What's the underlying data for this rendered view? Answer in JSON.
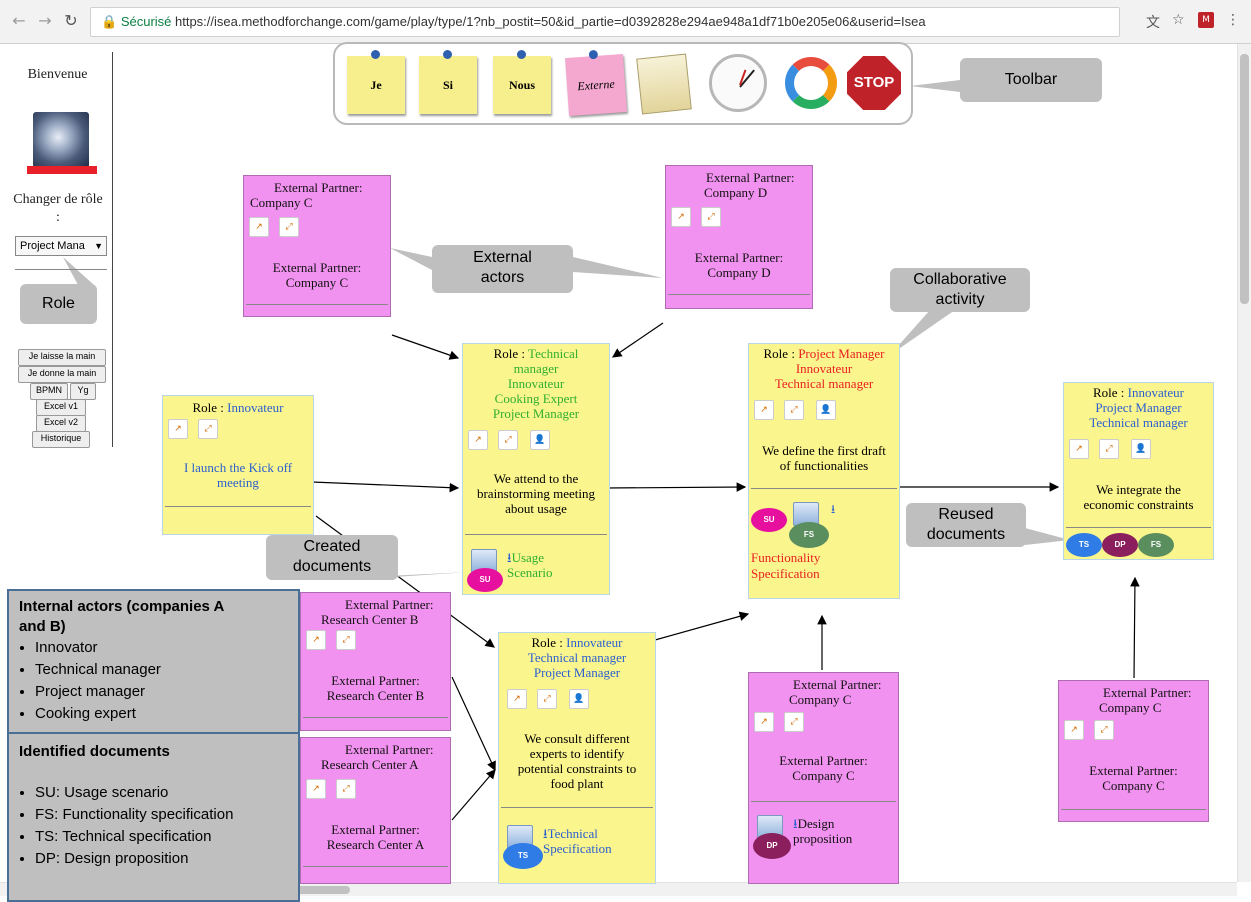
{
  "browser": {
    "secure_label": "Sécurisé",
    "url": "https://isea.methodforchange.com/game/play/type/1?nb_postit=50&id_partie=d0392828e294ae948a1df71b0e205e06&userid=Isea"
  },
  "sidebar": {
    "welcome": "Bienvenue",
    "change_role": "Changer de rôle",
    "change_role_colon": ":",
    "role_value": "Project Mana",
    "buttons": {
      "leave_hand": "Je laisse la main",
      "give_hand": "Je donne la main",
      "bpmn": "BPMN",
      "yg": "Yg",
      "excel_v1": "Excel v1",
      "excel_v2": "Excel v2",
      "history": "Historique"
    }
  },
  "toolbar": {
    "notes": [
      "Je",
      "Si",
      "Nous",
      "Externe"
    ],
    "stop_label": "STOP"
  },
  "callouts": {
    "toolbar": "Toolbar",
    "external_actors": [
      "External",
      "actors"
    ],
    "role": "Role",
    "collaborative": [
      "Collaborative",
      "activity"
    ],
    "created_docs": [
      "Created",
      "documents"
    ],
    "reused_docs": [
      "Reused",
      "documents"
    ]
  },
  "pink_cards": [
    {
      "top": "External Partner:",
      "top2": "Company C",
      "bottom": "External Partner:",
      "bottom2": "Company C"
    },
    {
      "top": "External Partner:",
      "top2": "Company D",
      "bottom": "External Partner:",
      "bottom2": "Company D"
    },
    {
      "top": "External Partner:",
      "top2": "Research Center B",
      "bottom": "External Partner:",
      "bottom2": "Research Center B"
    },
    {
      "top": "External Partner:",
      "top2": "Research Center A",
      "bottom": "External Partner:",
      "bottom2": "Research Center A"
    },
    {
      "top": "External Partner:",
      "top2": "Company C",
      "bottom": "External Partner:",
      "bottom2": "Company C",
      "doc": "Design",
      "doc2": "proposition"
    },
    {
      "top": "External Partner:",
      "top2": "Company C",
      "bottom": "External Partner:",
      "bottom2": "Company C"
    }
  ],
  "yellow_cards": {
    "innovateur": {
      "role_label": "Role :",
      "roles": [
        "Innovateur"
      ],
      "text": [
        "I launch the Kick off",
        "meeting"
      ]
    },
    "brainstorm": {
      "role_label": "Role :",
      "roles": [
        "Technical",
        "manager",
        "Innovateur",
        "Cooking Expert",
        "Project Manager"
      ],
      "text": [
        "We attend to the",
        "brainstorming meeting",
        "about usage"
      ],
      "doc": [
        "Usage",
        "Scenario"
      ]
    },
    "first_draft": {
      "role_label": "Role :",
      "roles": [
        "Project Manager",
        "Innovateur",
        "Technical manager"
      ],
      "text": [
        "We define the first draft",
        "of functionalities"
      ],
      "doc": [
        "Functionality",
        "Specification"
      ]
    },
    "consult": {
      "role_label": "Role :",
      "roles": [
        "Innovateur",
        "Technical manager",
        "Project Manager"
      ],
      "text": [
        "We consult different",
        "experts to identify",
        "potential constraints to",
        "food plant"
      ],
      "doc": [
        "Technical",
        "Specification"
      ]
    },
    "integrate": {
      "role_label": "Role :",
      "roles": [
        "Innovateur",
        "Project Manager",
        "Technical manager"
      ],
      "text": [
        "We integrate the",
        "economic constraints"
      ]
    }
  },
  "bubbles": {
    "su": "SU",
    "fs": "FS",
    "ts": "TS",
    "dp": "DP"
  },
  "legend_internal": {
    "title": "Internal actors (companies A and B)",
    "items": [
      "Innovator",
      "Technical manager",
      "Project manager",
      "Cooking expert"
    ]
  },
  "legend_docs": {
    "title": "Identified documents",
    "items": [
      "SU: Usage scenario",
      "FS: Functionality specification",
      "TS: Technical specification",
      "DP: Design proposition"
    ]
  },
  "colors": {
    "pink": "#f292f0",
    "yellow": "#fbf58e",
    "green_role": "#2fb02f",
    "red_role": "#e82020",
    "blue_role": "#2a5fd0"
  }
}
